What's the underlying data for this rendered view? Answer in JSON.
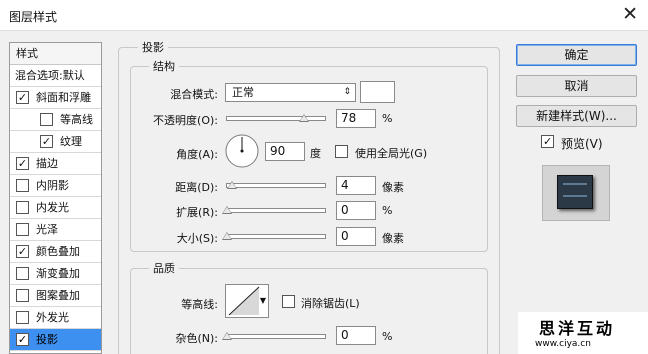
{
  "window": {
    "title": "图层样式",
    "close_glyph": "✕"
  },
  "style_list": {
    "header": "样式",
    "blend_options": "混合选项:默认",
    "items": [
      {
        "label": "斜面和浮雕",
        "checked": true,
        "level": 0
      },
      {
        "label": "等高线",
        "checked": false,
        "level": 1
      },
      {
        "label": "纹理",
        "checked": true,
        "level": 1
      },
      {
        "label": "描边",
        "checked": true,
        "level": 0
      },
      {
        "label": "内阴影",
        "checked": false,
        "level": 0
      },
      {
        "label": "内发光",
        "checked": false,
        "level": 0
      },
      {
        "label": "光泽",
        "checked": false,
        "level": 0
      },
      {
        "label": "颜色叠加",
        "checked": true,
        "level": 0
      },
      {
        "label": "渐变叠加",
        "checked": false,
        "level": 0
      },
      {
        "label": "图案叠加",
        "checked": false,
        "level": 0
      },
      {
        "label": "外发光",
        "checked": false,
        "level": 0
      },
      {
        "label": "投影",
        "checked": true,
        "level": 0,
        "selected": true
      }
    ]
  },
  "drop_shadow": {
    "title": "投影",
    "structure": {
      "title": "结构",
      "blend_mode_label": "混合模式:",
      "blend_mode_value": "正常",
      "blend_mode_arrow": "⇕",
      "swatch_color": "#ffffff",
      "opacity_label": "不透明度(O):",
      "opacity_value": "78",
      "opacity_unit": "%",
      "opacity_level": 0.78,
      "angle_label": "角度(A):",
      "angle_value": "90",
      "angle_unit": "度",
      "global_light_label": "使用全局光(G)",
      "global_light_checked": false,
      "distance_label": "距离(D):",
      "distance_value": "4",
      "distance_unit": "像素",
      "spread_label": "扩展(R):",
      "spread_value": "0",
      "spread_unit": "%",
      "size_label": "大小(S):",
      "size_value": "0",
      "size_unit": "像素"
    },
    "quality": {
      "title": "品质",
      "contour_label": "等高线:",
      "antialias_label": "消除锯齿(L)",
      "antialias_checked": false,
      "noise_label": "杂色(N):",
      "noise_value": "0",
      "noise_unit": "%"
    }
  },
  "buttons": {
    "ok": "确定",
    "cancel": "取消",
    "new_style": "新建样式(W)...",
    "preview_label": "预览(V)",
    "preview_checked": true
  },
  "watermark": {
    "brand": "思洋互动",
    "url": "www.ciya.cn"
  },
  "colors": {
    "selected_row": "#3d8ff0",
    "default_button_border": "#3a7bd5"
  }
}
